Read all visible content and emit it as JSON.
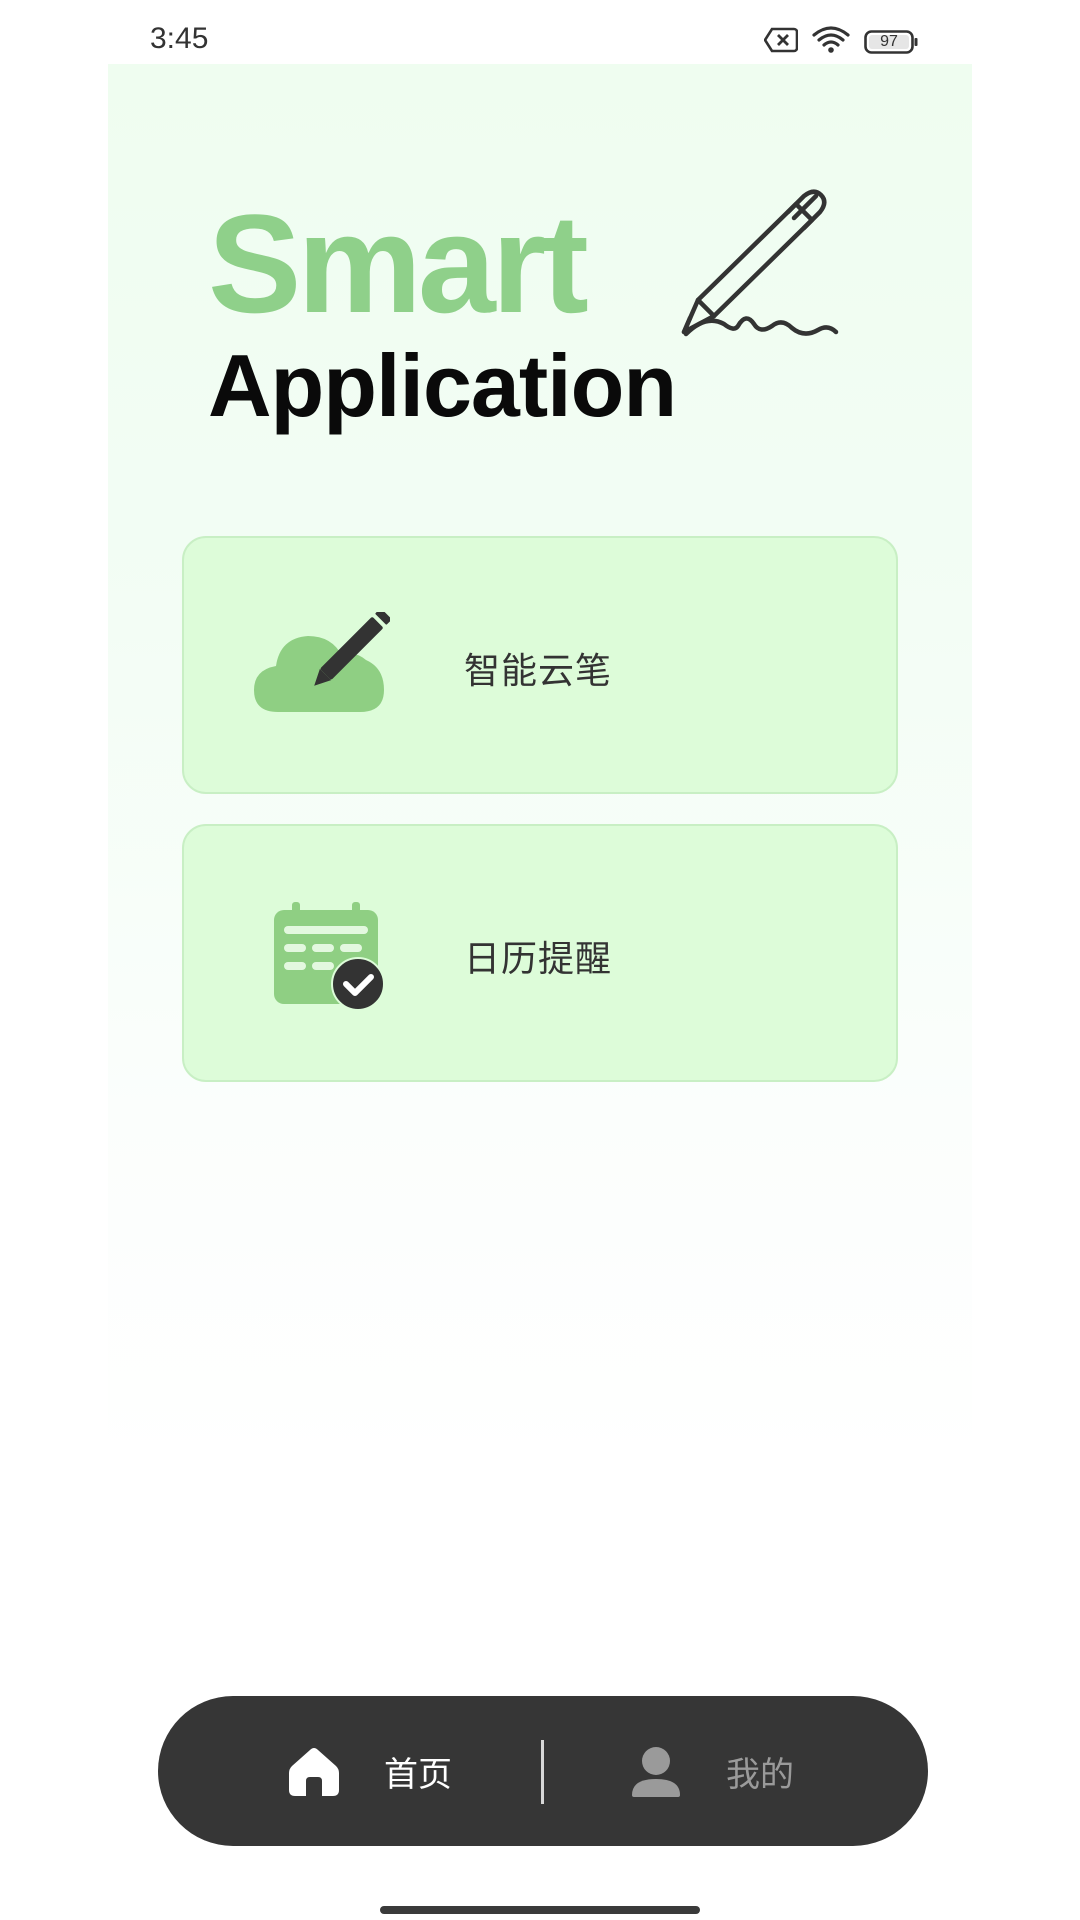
{
  "status_bar": {
    "time": "3:45",
    "battery_level": "97",
    "icons": [
      "sim-off-icon",
      "wifi-icon",
      "battery-icon"
    ]
  },
  "header": {
    "title_line1": "Smart",
    "title_line2": "Application",
    "illustration": "pen-signature-icon"
  },
  "cards": [
    {
      "label": "智能云笔",
      "icon": "cloud-pen-icon"
    },
    {
      "label": "日历提醒",
      "icon": "calendar-check-icon"
    }
  ],
  "bottom_nav": {
    "items": [
      {
        "label": "首页",
        "icon": "home-icon",
        "active": true
      },
      {
        "label": "我的",
        "icon": "user-icon",
        "active": false
      }
    ]
  },
  "colors": {
    "accent_green": "#8fd08a",
    "card_bg": "#ddfcd9",
    "nav_bg": "#363636"
  }
}
